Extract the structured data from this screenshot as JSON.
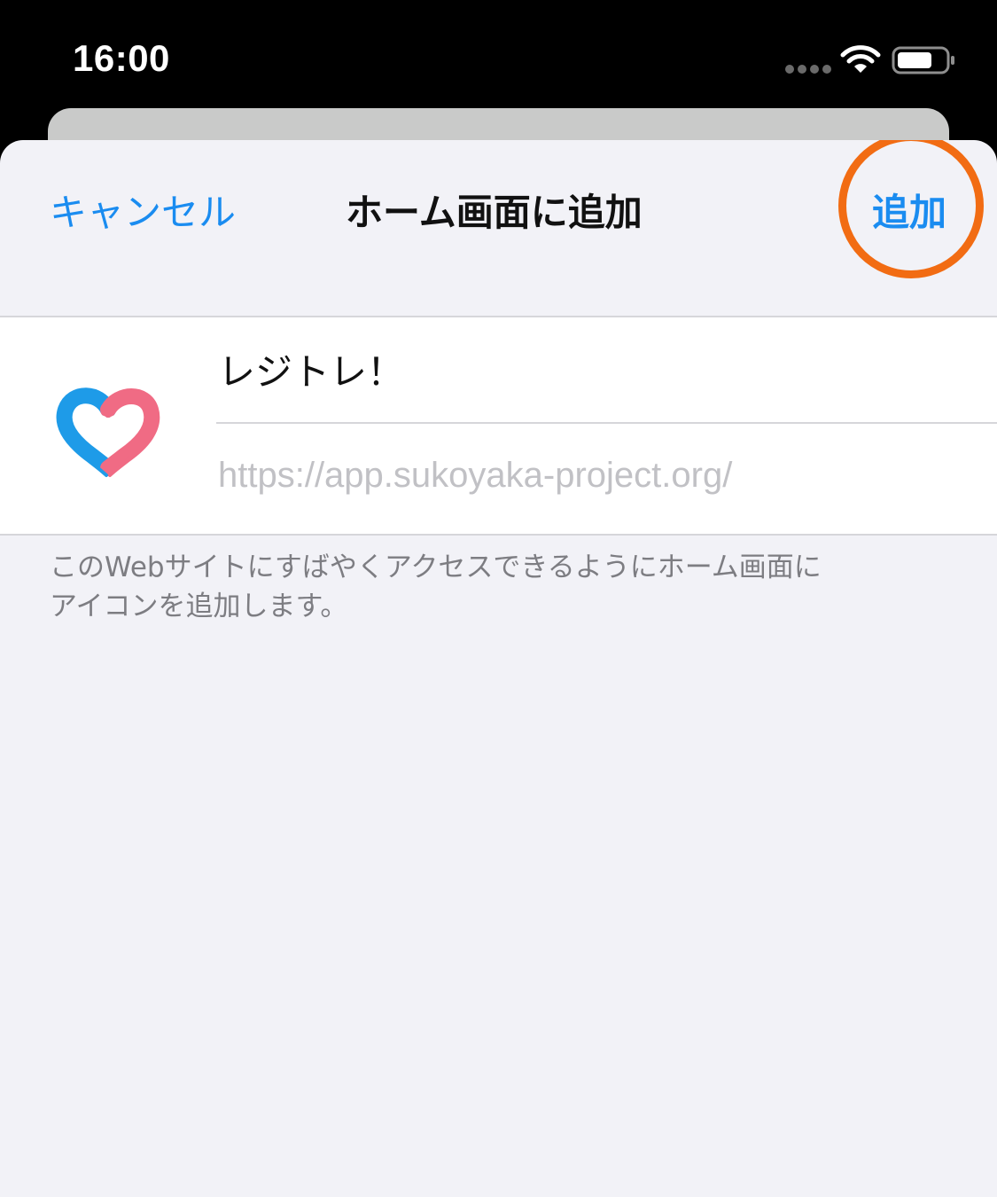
{
  "status_bar": {
    "time": "16:00"
  },
  "nav": {
    "cancel_label": "キャンセル",
    "title": "ホーム画面に追加",
    "add_label": "追加"
  },
  "form": {
    "app_name": "レジトレ！",
    "url": "https://app.sukoyaka-project.org/"
  },
  "footer": {
    "line1": "このWebサイトにすばやくアクセスできるようにホーム画面に",
    "line2": "アイコンを追加します。"
  },
  "colors": {
    "accent": "#1a8cf0",
    "highlight": "#f26c13",
    "icon_blue": "#1e9be8",
    "icon_pink": "#f06b84",
    "sheet_background": "#f2f2f7"
  },
  "icons": {
    "wifi": "wifi-icon",
    "battery": "battery-icon",
    "signal": "cellular-signal-icon",
    "app": "heart-logo-icon"
  }
}
